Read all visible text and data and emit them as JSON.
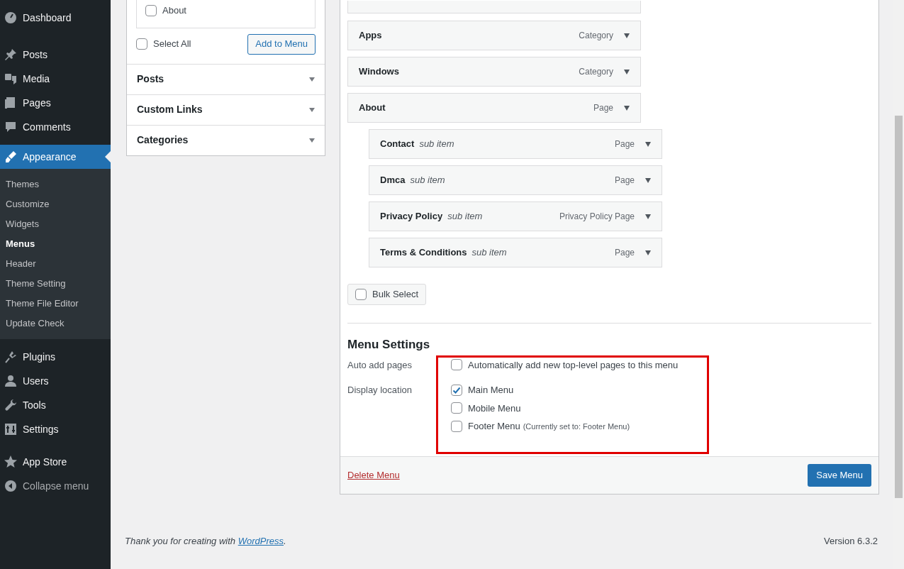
{
  "sidebar": {
    "items": [
      {
        "label": "Dashboard",
        "selected": false
      },
      {
        "label": "Posts",
        "selected": false
      },
      {
        "label": "Media",
        "selected": false
      },
      {
        "label": "Pages",
        "selected": false
      },
      {
        "label": "Comments",
        "selected": false
      },
      {
        "label": "Appearance",
        "selected": true,
        "children": [
          {
            "label": "Themes",
            "selected": false
          },
          {
            "label": "Customize",
            "selected": false
          },
          {
            "label": "Widgets",
            "selected": false
          },
          {
            "label": "Menus",
            "selected": true
          },
          {
            "label": "Header",
            "selected": false
          },
          {
            "label": "Theme Setting",
            "selected": false
          },
          {
            "label": "Theme File Editor",
            "selected": false
          },
          {
            "label": "Update Check",
            "selected": false
          }
        ]
      },
      {
        "label": "Plugins",
        "selected": false
      },
      {
        "label": "Users",
        "selected": false
      },
      {
        "label": "Tools",
        "selected": false
      },
      {
        "label": "Settings",
        "selected": false
      },
      {
        "label": "App Store",
        "selected": false
      },
      {
        "label": "Collapse menu",
        "selected": false,
        "kind": "collapse"
      }
    ]
  },
  "add_items": {
    "pages": [
      {
        "label": "About",
        "checked": false
      }
    ],
    "select_all": {
      "label": "Select All",
      "checked": false
    },
    "add_button": "Add to Menu",
    "sections": [
      {
        "title": "Posts"
      },
      {
        "title": "Custom Links"
      },
      {
        "title": "Categories"
      }
    ]
  },
  "menu_structure": {
    "cut_bar_above": true,
    "items": [
      {
        "title": "Apps",
        "type": "Category"
      },
      {
        "title": "Windows",
        "type": "Category"
      },
      {
        "title": "About",
        "type": "Page",
        "children": [
          {
            "title": "Contact",
            "note": "sub item",
            "type": "Page"
          },
          {
            "title": "Dmca",
            "note": "sub item",
            "type": "Page"
          },
          {
            "title": "Privacy Policy",
            "note": "sub item",
            "type": "Privacy Policy Page"
          },
          {
            "title": "Terms & Conditions",
            "note": "sub item",
            "type": "Page"
          }
        ]
      }
    ],
    "bulk_select": {
      "label": "Bulk Select",
      "checked": false
    }
  },
  "menu_settings": {
    "title": "Menu Settings",
    "auto_add": {
      "label": "Auto add pages",
      "options": [
        {
          "label": "Automatically add new top-level pages to this menu",
          "checked": false
        }
      ]
    },
    "display_location": {
      "label": "Display location",
      "options": [
        {
          "label": "Main Menu",
          "checked": true
        },
        {
          "label": "Mobile Menu",
          "checked": false
        },
        {
          "label": "Footer Menu",
          "checked": false,
          "note": "(Currently set to: Footer Menu)"
        }
      ]
    }
  },
  "actions": {
    "delete": "Delete Menu",
    "save": "Save Menu"
  },
  "footer": {
    "thanks": "Thank you for creating with",
    "link": "WordPress",
    "end": ".",
    "version": "Version 6.3.2"
  }
}
